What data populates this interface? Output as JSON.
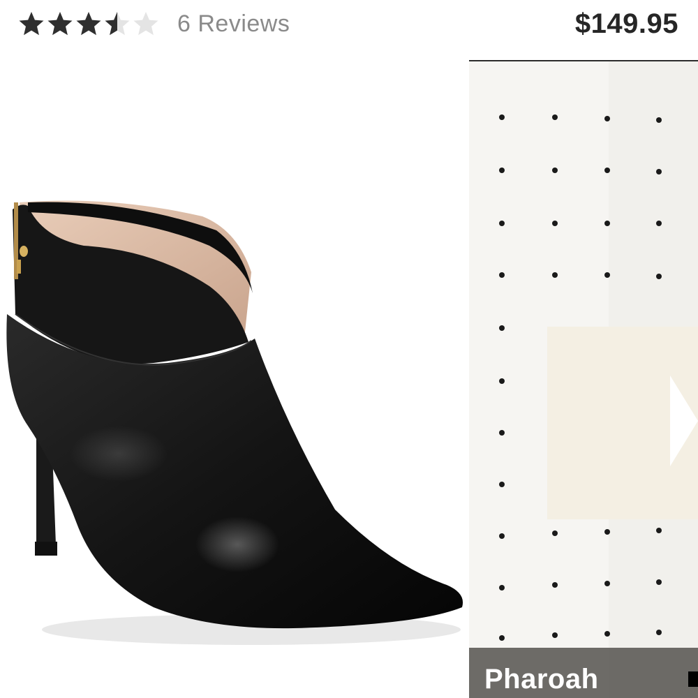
{
  "rating": {
    "value": 3.5,
    "max": 5,
    "reviews_label": "6 Reviews",
    "filled_color": "#2f2f2f",
    "empty_color": "#e4e4e4",
    "star_icon": "star-icon"
  },
  "price": "$149.95",
  "main_image": {
    "icon": "black-pointed-toe-ankle-bootie-image"
  },
  "video": {
    "caption": "Pharoah",
    "play_icon": "play-icon"
  }
}
